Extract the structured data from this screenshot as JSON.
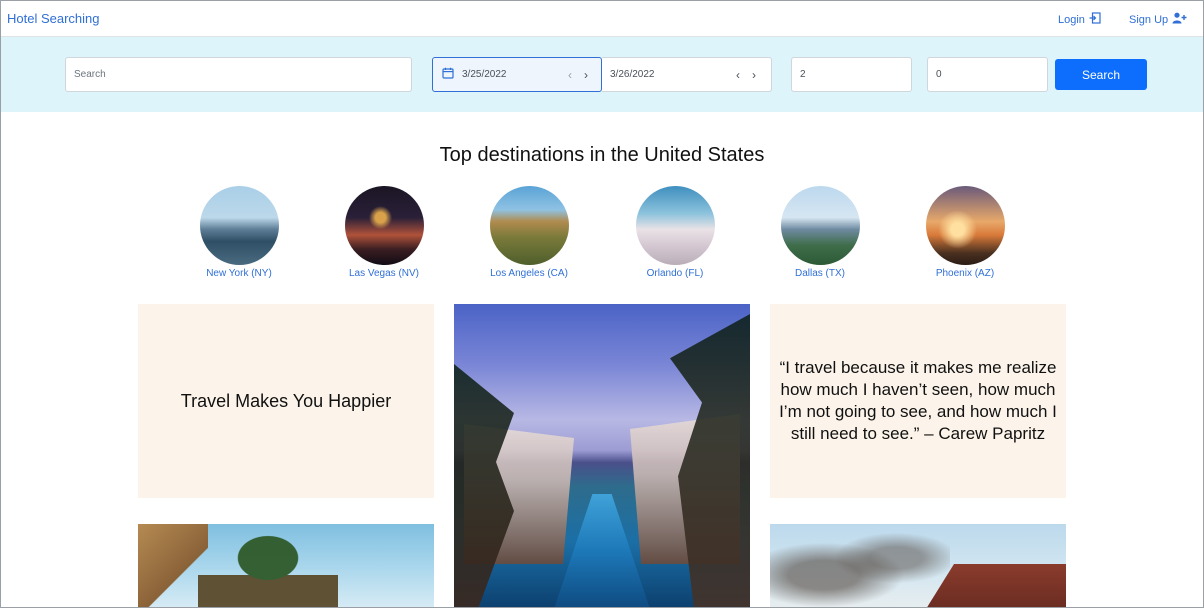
{
  "navbar": {
    "brand": "Hotel Searching",
    "login_label": "Login",
    "signup_label": "Sign Up"
  },
  "search_bar": {
    "search_placeholder": "Search",
    "check_in": "3/25/2022",
    "check_out": "3/26/2022",
    "guests_value": "2",
    "rooms_value": "0",
    "search_button": "Search"
  },
  "destinations": {
    "title": "Top destinations in the United States",
    "items": [
      {
        "label": "New York (NY)"
      },
      {
        "label": "Las Vegas (NV)"
      },
      {
        "label": "Los Angeles (CA)"
      },
      {
        "label": "Orlando (FL)"
      },
      {
        "label": "Dallas (TX)"
      },
      {
        "label": "Phoenix (AZ)"
      }
    ]
  },
  "cards": {
    "headline": "Travel Makes You Happier",
    "quote": "“I travel because it makes me realize how much I haven’t seen, how much I’m not going to see, and how much I still need to see.” – Carew Papritz"
  },
  "icons": {
    "login": "login-icon",
    "signup": "add-user-icon",
    "calendar": "calendar-icon",
    "prev": "chevron-left-icon",
    "next": "chevron-right-icon"
  },
  "colors": {
    "accent": "#0d6efd",
    "link": "#2f6fd6",
    "search_band": "#def4fb",
    "card_bg": "#fcf4ea"
  }
}
